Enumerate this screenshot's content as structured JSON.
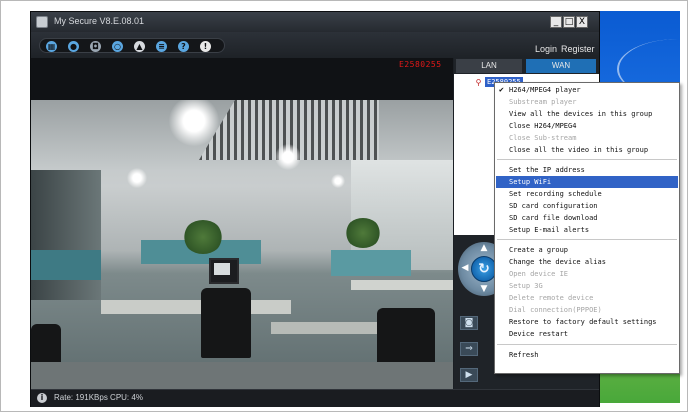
{
  "app": {
    "title": "My Secure  V8.E.08.01",
    "camera_id": "E2580255",
    "window_controls": {
      "minimize": "_",
      "maximize": "□",
      "close": "X"
    }
  },
  "toolbar": {
    "icons": [
      "grid-icon",
      "record-icon",
      "snapshot-icon",
      "search-icon",
      "lock-icon",
      "settings-icon",
      "help-icon",
      "alert-icon"
    ],
    "login_label": "Login",
    "register_label": "Register"
  },
  "tabs": {
    "lan": "LAN",
    "wan": "WAN"
  },
  "device": {
    "name": "E2580255"
  },
  "status": {
    "text": "Rate: 191KBps  CPU:   4%"
  },
  "context_menu": {
    "items": [
      {
        "label": "H264/MPEG4 player",
        "checked": true,
        "enabled": true
      },
      {
        "label": "Substream player",
        "enabled": false
      },
      {
        "label": "View all the devices in this group",
        "enabled": true
      },
      {
        "label": "Close H264/MPEG4",
        "enabled": true
      },
      {
        "label": "Close Sub-stream",
        "enabled": false
      },
      {
        "label": "Close all the video in this group",
        "enabled": true
      },
      {
        "label": "Set the IP address",
        "enabled": true
      },
      {
        "label": "Setup WiFi",
        "enabled": true,
        "highlighted": true
      },
      {
        "label": "Set recording schedule",
        "enabled": true
      },
      {
        "label": "SD card configuration",
        "enabled": true
      },
      {
        "label": "SD card file download",
        "enabled": true
      },
      {
        "label": "Setup E-mail alerts",
        "enabled": true
      },
      {
        "label": "Create a group",
        "enabled": true
      },
      {
        "label": "Change the device alias",
        "enabled": true
      },
      {
        "label": "Open device IE",
        "enabled": false
      },
      {
        "label": "Setup 3G",
        "enabled": false
      },
      {
        "label": "Delete remote device",
        "enabled": false
      },
      {
        "label": "Dial connection(PPPOE)",
        "enabled": false
      },
      {
        "label": "Restore to factory default settings",
        "enabled": true
      },
      {
        "label": "Device restart",
        "enabled": true
      },
      {
        "label": "Refresh",
        "enabled": true
      }
    ]
  },
  "colors": {
    "accent": "#3163c6",
    "camera_id": "#e01818",
    "tab_wan": "#1f6fb5"
  }
}
